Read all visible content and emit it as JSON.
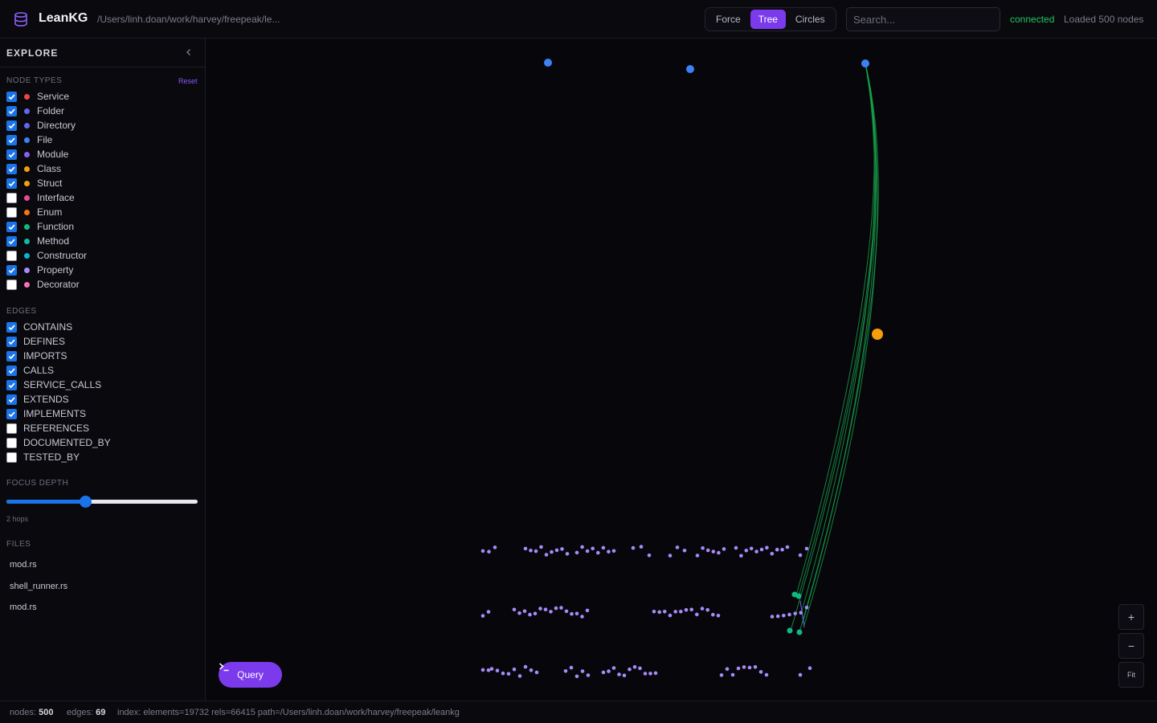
{
  "header": {
    "title": "LeanKG",
    "path": "/Users/linh.doan/work/harvey/freepeak/le...",
    "layouts": [
      {
        "label": "Force",
        "active": false
      },
      {
        "label": "Tree",
        "active": true
      },
      {
        "label": "Circles",
        "active": false
      }
    ],
    "search_placeholder": "Search...",
    "status": "connected",
    "loaded": "Loaded 500 nodes",
    "logo_icon": "database-icon"
  },
  "sidebar": {
    "title": "EXPLORE",
    "collapse_icon": "chevron-left-icon",
    "node_types_title": "NODE TYPES",
    "reset_label": "Reset",
    "node_types": [
      {
        "label": "Service",
        "checked": true,
        "color": "#ef4444"
      },
      {
        "label": "Folder",
        "checked": true,
        "color": "#6366f1"
      },
      {
        "label": "Directory",
        "checked": true,
        "color": "#6366f1"
      },
      {
        "label": "File",
        "checked": true,
        "color": "#3b82f6"
      },
      {
        "label": "Module",
        "checked": true,
        "color": "#8b5cf6"
      },
      {
        "label": "Class",
        "checked": true,
        "color": "#f59e0b"
      },
      {
        "label": "Struct",
        "checked": true,
        "color": "#f59e0b"
      },
      {
        "label": "Interface",
        "checked": false,
        "color": "#ec4899"
      },
      {
        "label": "Enum",
        "checked": false,
        "color": "#f97316"
      },
      {
        "label": "Function",
        "checked": true,
        "color": "#10b981"
      },
      {
        "label": "Method",
        "checked": true,
        "color": "#14b8a6"
      },
      {
        "label": "Constructor",
        "checked": false,
        "color": "#06b6d4"
      },
      {
        "label": "Property",
        "checked": true,
        "color": "#a78bfa"
      },
      {
        "label": "Decorator",
        "checked": false,
        "color": "#f472b6"
      }
    ],
    "edges_title": "EDGES",
    "edges": [
      {
        "label": "CONTAINS",
        "checked": true
      },
      {
        "label": "DEFINES",
        "checked": true
      },
      {
        "label": "IMPORTS",
        "checked": true
      },
      {
        "label": "CALLS",
        "checked": true
      },
      {
        "label": "SERVICE_CALLS",
        "checked": true
      },
      {
        "label": "EXTENDS",
        "checked": true
      },
      {
        "label": "IMPLEMENTS",
        "checked": true
      },
      {
        "label": "REFERENCES",
        "checked": false
      },
      {
        "label": "DOCUMENTED_BY",
        "checked": false
      },
      {
        "label": "TESTED_BY",
        "checked": false
      }
    ],
    "focus_depth_title": "FOCUS DEPTH",
    "focus_depth_fraction": 0.41,
    "hops_label": "2 hops",
    "files_title": "FILES",
    "files": [
      "mod.rs",
      "shell_runner.rs",
      "mod.rs"
    ]
  },
  "canvas": {
    "query_label": "Query",
    "query_icon": "terminal-icon",
    "zoom_in_label": "+",
    "zoom_out_label": "−",
    "fit_label": "Fit",
    "colors": {
      "file": "#3b82f6",
      "class": "#f59e0b",
      "function": "#10b981",
      "property": "#a78bfa",
      "edge_calls": "#16a34a",
      "edge_contains": "#6366f1"
    }
  },
  "footer": {
    "nodes_label": "nodes:",
    "nodes_value": "500",
    "edges_label": "edges:",
    "edges_value": "69",
    "index_label": "index: elements=19732 rels=66415 path=/Users/linh.doan/work/harvey/freepeak/leankg"
  }
}
